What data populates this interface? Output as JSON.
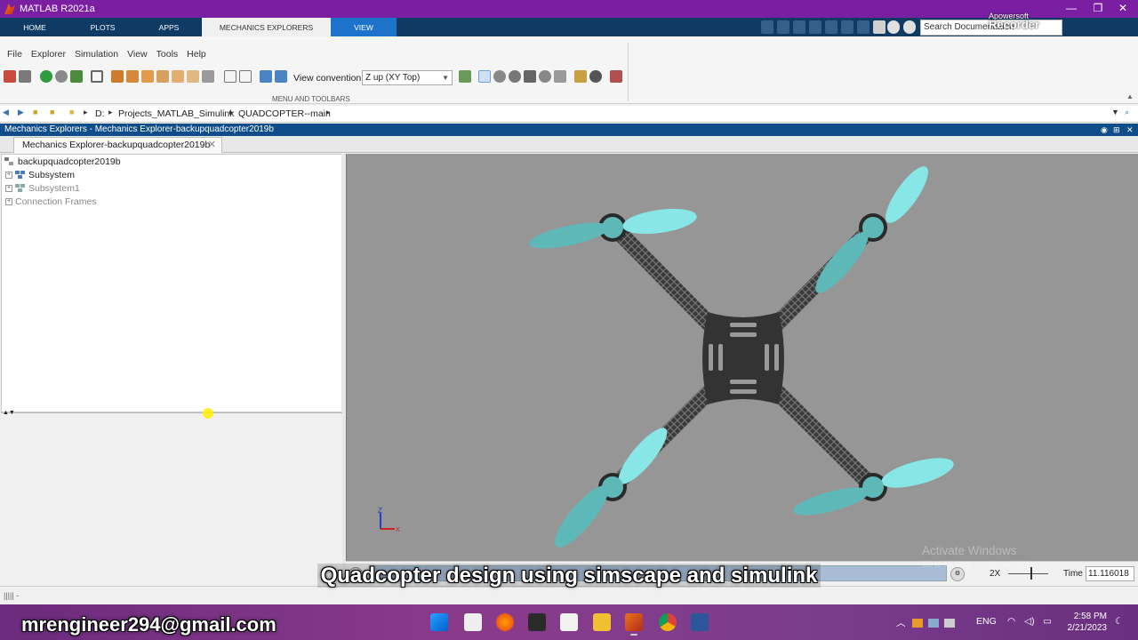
{
  "window": {
    "title": "MATLAB R2021a"
  },
  "tabs": [
    {
      "label": "HOME"
    },
    {
      "label": "PLOTS"
    },
    {
      "label": "APPS"
    },
    {
      "label": "MECHANICS EXPLORERS"
    },
    {
      "label": "VIEW"
    }
  ],
  "search": {
    "placeholder": "Search Documentation"
  },
  "recorder": {
    "line1": "Apowersoft",
    "line2": "Recorder"
  },
  "menu": [
    "File",
    "Explorer",
    "Simulation",
    "View",
    "Tools",
    "Help"
  ],
  "toolbar": {
    "view_convention_label": "View convention:",
    "view_convention_value": "Z up (XY Top)",
    "section_label": "MENU AND TOOLBARS"
  },
  "address": {
    "crumbs": [
      "D:",
      "Projects_MATLAB_Simulink",
      "QUADCOPTER--main"
    ]
  },
  "explorer": {
    "header": "Mechanics Explorers - Mechanics Explorer-backupquadcopter2019b",
    "doc_tab": "Mechanics Explorer-backupquadcopter2019b",
    "tree": {
      "root": "backupquadcopter2019b",
      "items": [
        "Subsystem",
        "Subsystem1",
        "Connection Frames"
      ]
    }
  },
  "axes_triad": {
    "z": "Z",
    "x": "X"
  },
  "playback": {
    "speed": "2X",
    "time_label": "Time",
    "time_value": "11.116018"
  },
  "watermark": {
    "line1": "Activate Windows",
    "line2": "Go to Settings to activate Windows."
  },
  "caption": "Quadcopter design using simscape and simulink",
  "overlay_email": "mrengineer294@gmail.com",
  "taskbar": {
    "lang": "ENG",
    "time": "2:58 PM",
    "date": "2/21/2023"
  },
  "colors": {
    "title_bar": "#7b1fa2",
    "ribbon": "#0e3a63",
    "view_tab": "#1d73c9",
    "viewport_bg": "#969696",
    "frame": "#333333",
    "propeller": "#5fb8b8"
  }
}
